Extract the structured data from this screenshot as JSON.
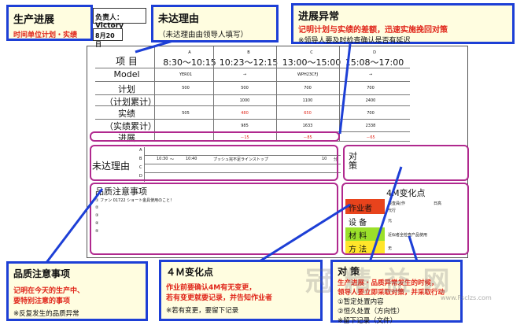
{
  "callouts": {
    "progress": {
      "title": "生产进展",
      "sub": "时间单位计划・实绩"
    },
    "reason": {
      "title": "未达理由",
      "sub": "（未达理由由领导人填写）"
    },
    "abnormal": {
      "title": "进展异常",
      "red": "记明计划与实绩的差额，迅速实施挽回对策",
      "note": "※领导人要及时检查确认是否有延迟"
    },
    "quality": {
      "title": "品质注意事项",
      "red1": "记明在今天的生产中、",
      "red2": "要特别注意的事项",
      "note": "※反复发生的品质异常"
    },
    "m4": {
      "title": "４Ｍ变化点",
      "red1": "作业前要确认4M有无变更，",
      "red2": "若有变更就要记录，并告知作业者",
      "note": "※若有变更，要留下记录"
    },
    "measures": {
      "title": "对 策",
      "red1": "生产进展・品质异常发生的时候，",
      "red2": "领导人要立即采取对策，并采取行动",
      "item1": "①暂定处置内容",
      "item2": "②恒久处置（方向性）",
      "item3": "※留下记录（文件）"
    }
  },
  "board": {
    "leader": "负责人：Victory",
    "date": "8月20日",
    "header_label": "项  目",
    "columns": [
      {
        "code": "A",
        "time": "8:30～10:15"
      },
      {
        "code": "B",
        "time": "10:23～12:15"
      },
      {
        "code": "C",
        "time": "13:00～15:00"
      },
      {
        "code": "D",
        "time": "15:08～17:00"
      }
    ],
    "rows": {
      "model": {
        "label": "Model",
        "values": [
          "YER01",
          "→",
          "WPH23CFJ",
          "→"
        ]
      },
      "plan": {
        "label": "计划",
        "values": [
          "500",
          "500",
          "700",
          "700"
        ]
      },
      "plan_cum": {
        "label": "（计划累计）",
        "values": [
          "",
          "1000",
          "1100",
          "2400"
        ]
      },
      "actual": {
        "label": "实绩",
        "values": [
          "505",
          "480",
          "650",
          "700"
        ]
      },
      "actual_cum": {
        "label": "（实绩累计）",
        "values": [
          "",
          "985",
          "1633",
          "2338"
        ]
      },
      "progress": {
        "label": "进展",
        "values": [
          "",
          "－15",
          "－85",
          "－65"
        ]
      }
    },
    "reason_label": "未达理由",
    "reason_codes": [
      "A",
      "B",
      "C",
      "D"
    ],
    "reason_entry": {
      "start": "10:30",
      "arrow": "～",
      "end": "10:40",
      "text": "プッシュ完不足ラインストップ",
      "minutes": "10",
      "unit": "分"
    },
    "measures_label": "对策",
    "quality_title": "品质注意事项",
    "quality_items": [
      "① ファン 01722 ショート金具使用のこと！",
      "②",
      "③",
      "④",
      "⑤"
    ],
    "m4_title": "4M变化点",
    "m4_rows": [
      {
        "label": "作业者",
        "value": "検査員(作",
        "extra": "日高",
        "sub": "代行"
      },
      {
        "label": "设  备",
        "value": "元"
      },
      {
        "label": "材  料",
        "value": "近似者全检查产品使用"
      },
      {
        "label": "方  法",
        "value": "无"
      }
    ]
  },
  "watermark": {
    "text": "冠 精 益 网",
    "url": "www.Fsclzs.com"
  }
}
